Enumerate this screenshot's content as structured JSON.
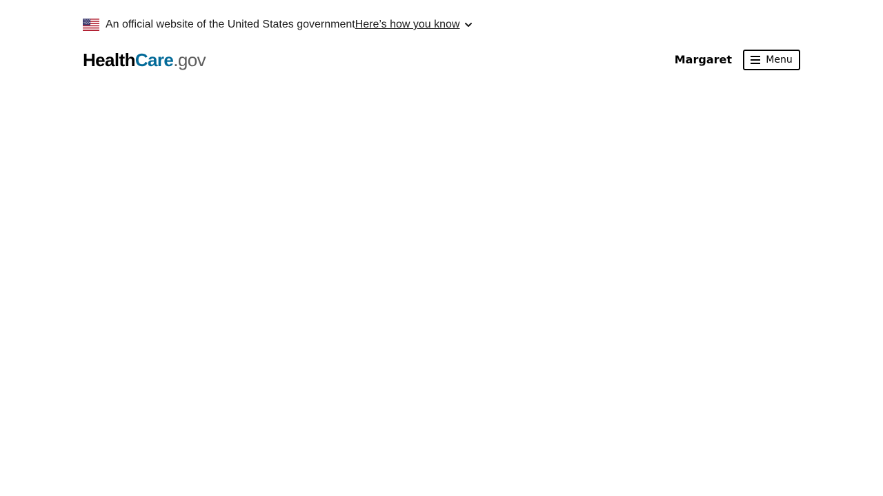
{
  "gov_banner": {
    "flag_icon": "us-flag-icon",
    "text": "An official website of the United States government",
    "link_text": "Here’s how you know",
    "toggle_icon": "chevron-down-icon"
  },
  "header": {
    "logo": {
      "part1": "Health",
      "part2": "Care",
      "part3": ".gov",
      "colors": {
        "health": "#000000",
        "care": "#046b99",
        "gov": "#5c5c5c"
      }
    },
    "user_name": "Margaret",
    "menu": {
      "icon": "hamburger-menu-icon",
      "label": "Menu"
    }
  }
}
